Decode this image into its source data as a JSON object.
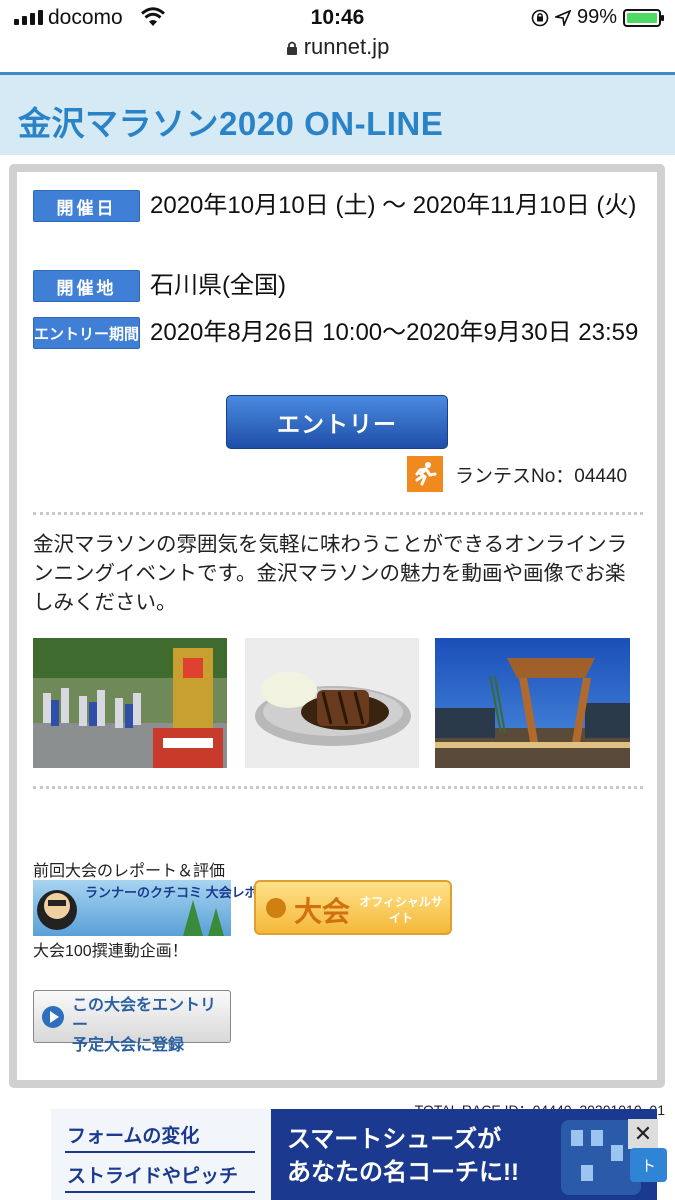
{
  "status_bar": {
    "carrier": "docomo",
    "time": "10:46",
    "battery": "99%",
    "battery_level": 0.99
  },
  "url_bar": {
    "domain": "runnet.jp"
  },
  "page": {
    "title": "金沢マラソン2020 ON-LINE"
  },
  "event": {
    "date_label": "開催日",
    "date_value": "2020年10月10日 (土) 〜 2020年11月10日 (火)",
    "venue_label": "開催地",
    "venue_value": "石川県(全国)",
    "entry_period_label": "エントリー期間",
    "entry_period_value": "2020年8月26日 10:00〜2020年9月30日 23:59",
    "entry_button": "エントリー",
    "runtes_no": "ランテスNo：04440"
  },
  "description": "金沢マラソンの雰囲気を気軽に味わうことができるオンラインランニングイベントです。金沢マラソンの魅力を動画や画像でお楽しみください。",
  "links": {
    "report_label": "前回大会のレポート＆評価",
    "runner_banner": "ランナーのクチコミ 大会レポ",
    "official_banner_main": "大会",
    "official_banner_sub": "オフィシャルサイト",
    "hundred_label": "大会100撰連動企画！",
    "register_button_line1": "この大会をエントリー",
    "register_button_line2": "予定大会に登録"
  },
  "footer": {
    "total_race_id": "TOTAL RACE ID：04440_20201010_01"
  },
  "ad": {
    "left_line1": "フォームの変化",
    "left_line2": "ストライドやピッチ",
    "main_line1": "スマートシューズが",
    "main_line2": "あなたの名コーチに!!",
    "close": "✕",
    "peek": "ト"
  }
}
